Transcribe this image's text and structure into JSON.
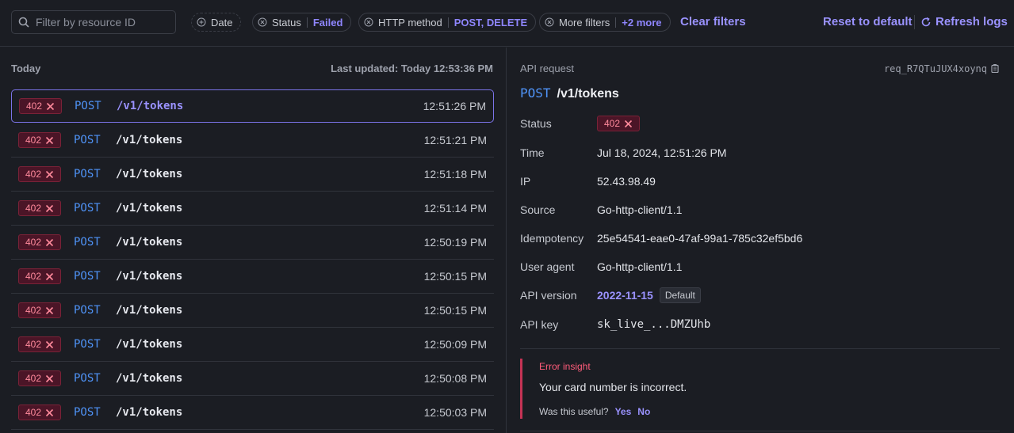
{
  "filters": {
    "search_placeholder": "Filter by resource ID",
    "date_label": "Date",
    "status_label": "Status",
    "status_value": "Failed",
    "method_label": "HTTP method",
    "method_value": "POST, DELETE",
    "more_label": "More filters",
    "more_value": "+2 more",
    "clear_label": "Clear filters",
    "reset_label": "Reset to default",
    "refresh_label": "Refresh logs"
  },
  "list": {
    "group_label": "Today",
    "last_updated": "Last updated: Today 12:53:36 PM",
    "rows": [
      {
        "status": "402",
        "method": "POST",
        "path": "/v1/tokens",
        "time": "12:51:26 PM"
      },
      {
        "status": "402",
        "method": "POST",
        "path": "/v1/tokens",
        "time": "12:51:21 PM"
      },
      {
        "status": "402",
        "method": "POST",
        "path": "/v1/tokens",
        "time": "12:51:18 PM"
      },
      {
        "status": "402",
        "method": "POST",
        "path": "/v1/tokens",
        "time": "12:51:14 PM"
      },
      {
        "status": "402",
        "method": "POST",
        "path": "/v1/tokens",
        "time": "12:50:19 PM"
      },
      {
        "status": "402",
        "method": "POST",
        "path": "/v1/tokens",
        "time": "12:50:15 PM"
      },
      {
        "status": "402",
        "method": "POST",
        "path": "/v1/tokens",
        "time": "12:50:15 PM"
      },
      {
        "status": "402",
        "method": "POST",
        "path": "/v1/tokens",
        "time": "12:50:09 PM"
      },
      {
        "status": "402",
        "method": "POST",
        "path": "/v1/tokens",
        "time": "12:50:08 PM"
      },
      {
        "status": "402",
        "method": "POST",
        "path": "/v1/tokens",
        "time": "12:50:03 PM"
      }
    ]
  },
  "detail": {
    "header": "API request",
    "request_id": "req_R7QTuJUX4xoynq",
    "method": "POST",
    "path": "/v1/tokens",
    "fields": {
      "status_label": "Status",
      "status_value": "402",
      "time_label": "Time",
      "time_value": "Jul 18, 2024, 12:51:26 PM",
      "ip_label": "IP",
      "ip_value": "52.43.98.49",
      "source_label": "Source",
      "source_value": "Go-http-client/1.1",
      "idempotency_label": "Idempotency",
      "idempotency_value": "25e54541-eae0-47af-99a1-785c32ef5bd6",
      "user_agent_label": "User agent",
      "user_agent_value": "Go-http-client/1.1",
      "api_version_label": "API version",
      "api_version_value": "2022-11-15",
      "api_version_badge": "Default",
      "api_key_label": "API key",
      "api_key_value": "sk_live_...DMZUhb"
    },
    "insight": {
      "heading": "Error insight",
      "message": "Your card number is incorrect.",
      "question": "Was this useful?",
      "yes": "Yes",
      "no": "No"
    }
  },
  "colors": {
    "accent": "#9a92ff",
    "method": "#4f93f7",
    "error": "#ff8a9c"
  }
}
